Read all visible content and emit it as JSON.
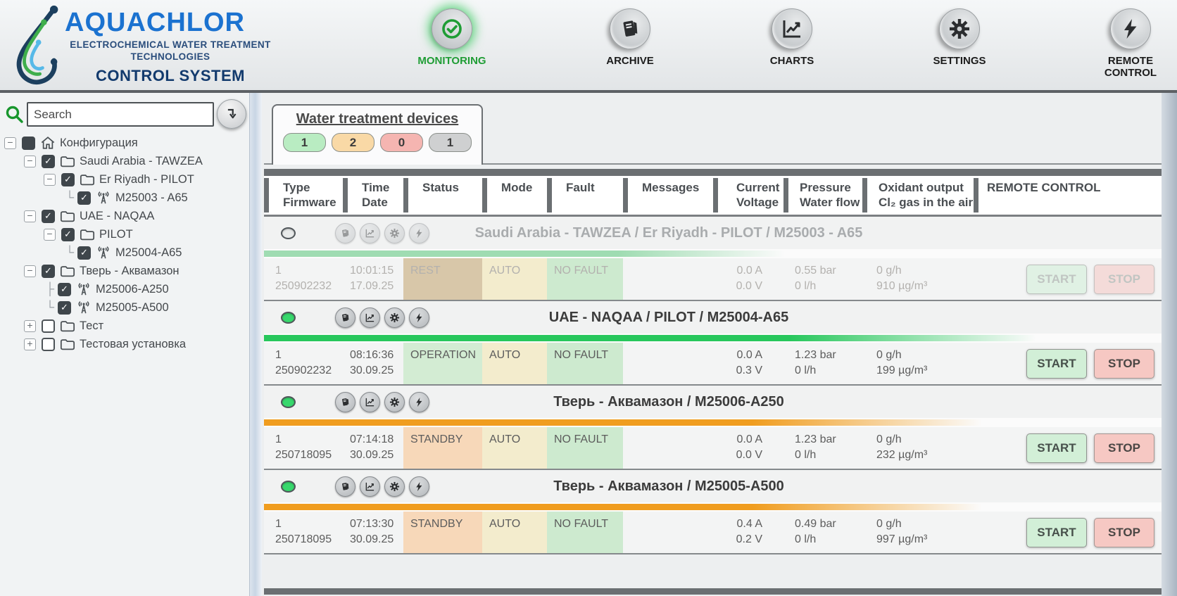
{
  "header": {
    "logo": {
      "title": "AQUACHLOR",
      "subtitle": "ELECTROCHEMICAL WATER TREATMENT TECHNOLOGIES",
      "tagline": "CONTROL SYSTEM"
    },
    "nav": [
      {
        "id": "monitoring",
        "label": "MONITORING",
        "icon": "check-circle",
        "active": true
      },
      {
        "id": "archive",
        "label": "ARCHIVE",
        "icon": "book",
        "active": false
      },
      {
        "id": "charts",
        "label": "CHARTS",
        "icon": "chart",
        "active": false
      },
      {
        "id": "settings",
        "label": "SETTINGS",
        "icon": "gear",
        "active": false
      },
      {
        "id": "remote",
        "label": "REMOTE CONTROL",
        "icon": "bolt",
        "active": false
      }
    ]
  },
  "sidebar": {
    "search_placeholder": "Search",
    "tree": [
      {
        "label": "Конфигурация",
        "level": 0,
        "expander": "minus",
        "checkbox": "filled",
        "icon": "home"
      },
      {
        "label": "Saudi Arabia - TAWZEA",
        "level": 1,
        "expander": "minus",
        "checkbox": "checked",
        "icon": "folder"
      },
      {
        "label": "Er Riyadh - PILOT",
        "level": 2,
        "expander": "minus",
        "checkbox": "checked",
        "icon": "folder"
      },
      {
        "label": "M25003 - A65",
        "level": 3,
        "connector": "└",
        "checkbox": "checked",
        "icon": "antenna"
      },
      {
        "label": "UAE - NAQAA",
        "level": 1,
        "expander": "minus",
        "checkbox": "checked",
        "icon": "folder"
      },
      {
        "label": "PILOT",
        "level": 2,
        "expander": "minus",
        "checkbox": "checked",
        "icon": "folder"
      },
      {
        "label": "M25004-A65",
        "level": 3,
        "connector": "└",
        "checkbox": "checked",
        "icon": "antenna"
      },
      {
        "label": "Тверь - Аквамазон",
        "level": 1,
        "expander": "minus",
        "checkbox": "checked",
        "icon": "folder"
      },
      {
        "label": "M25006-A250",
        "level": 2,
        "connector": "├",
        "checkbox": "checked",
        "icon": "antenna"
      },
      {
        "label": "M25005-A500",
        "level": 2,
        "connector": "└",
        "checkbox": "checked",
        "icon": "antenna"
      },
      {
        "label": "Тест",
        "level": 1,
        "expander": "plus",
        "checkbox": "empty",
        "icon": "folder"
      },
      {
        "label": "Тестовая установка",
        "level": 1,
        "expander": "plus",
        "checkbox": "empty",
        "icon": "folder"
      }
    ]
  },
  "main": {
    "tab": {
      "title": "Water treatment devices",
      "badges": [
        {
          "value": "1",
          "color": "badge_green"
        },
        {
          "value": "2",
          "color": "badge_orange"
        },
        {
          "value": "0",
          "color": "badge_red"
        },
        {
          "value": "1",
          "color": "badge_gray"
        }
      ]
    },
    "columns": [
      [
        "Type",
        "Firmware"
      ],
      [
        "Time",
        "Date"
      ],
      [
        "Status"
      ],
      [
        "Mode"
      ],
      [
        "Fault"
      ],
      [
        "Messages"
      ],
      [
        "Current",
        "Voltage"
      ],
      [
        "Pressure",
        "Water flow"
      ],
      [
        "Oxidant output",
        "Cl₂ gas in the air"
      ],
      [
        "REMOTE CONTROL"
      ]
    ],
    "buttons": {
      "start": "START",
      "stop": "STOP"
    },
    "devices": [
      {
        "name": "Saudi Arabia - TAWZEA / Er Riyadh - PILOT / M25003 - A65",
        "online": false,
        "type": "1",
        "firmware": "250902232",
        "time": "10:01:15",
        "date": "17.09.25",
        "status": "REST",
        "status_color": "status_rest",
        "mode": "AUTO",
        "mode_color": "mode_auto",
        "fault": "NO FAULT",
        "fault_color": "fault_ok",
        "messages": "",
        "current": "0.0 A",
        "voltage": "0.0 V",
        "pressure": "0.55 bar",
        "flow": "0 l/h",
        "oxidant": "0 g/h",
        "gas": "910 µg/m³",
        "bar_color": "bar_pale_green",
        "bar_width": "58%"
      },
      {
        "name": "UAE - NAQAA / PILOT / M25004-A65",
        "online": true,
        "type": "1",
        "firmware": "250902232",
        "time": "08:16:36",
        "date": "30.09.25",
        "status": "OPERATION",
        "status_color": "status_operation",
        "mode": "AUTO",
        "mode_color": "mode_auto",
        "fault": "NO FAULT",
        "fault_color": "fault_ok",
        "messages": "",
        "current": "0.0 A",
        "voltage": "0.3 V",
        "pressure": "1.23 bar",
        "flow": "0 l/h",
        "oxidant": "0 g/h",
        "gas": "199 µg/m³",
        "bar_color": "bar_green",
        "bar_width": "86%"
      },
      {
        "name": "Тверь - Аквамазон / M25006-A250",
        "online": true,
        "type": "1",
        "firmware": "250718095",
        "time": "07:14:18",
        "date": "30.09.25",
        "status": "STANDBY",
        "status_color": "status_standby",
        "mode": "AUTO",
        "mode_color": "mode_auto",
        "fault": "NO FAULT",
        "fault_color": "fault_ok",
        "messages": "",
        "current": "0.0 A",
        "voltage": "0.0 V",
        "pressure": "1.23 bar",
        "flow": "0 l/h",
        "oxidant": "0 g/h",
        "gas": "232 µg/m³",
        "bar_color": "bar_orange",
        "bar_width": "80%"
      },
      {
        "name": "Тверь - Аквамазон / M25005-A500",
        "online": true,
        "type": "1",
        "firmware": "250718095",
        "time": "07:13:30",
        "date": "30.09.25",
        "status": "STANDBY",
        "status_color": "status_standby",
        "mode": "AUTO",
        "mode_color": "mode_auto",
        "fault": "NO FAULT",
        "fault_color": "fault_ok",
        "messages": "",
        "current": "0.4 A",
        "voltage": "0.2 V",
        "pressure": "0.49 bar",
        "flow": "0 l/h",
        "oxidant": "0 g/h",
        "gas": "997 µg/m³",
        "bar_color": "bar_orange",
        "bar_width": "80%"
      }
    ]
  },
  "colors": {
    "accent_green": "#1f9d35",
    "badge_green": "#b9ecc2",
    "badge_orange": "#f9d9a6",
    "badge_red": "#f5b5b1",
    "badge_gray": "#cfd0d1",
    "status_rest": "#d8c7a9",
    "status_operation": "#d3ecd3",
    "status_standby": "#f7d8b9",
    "mode_auto": "#f3eccd",
    "fault_ok": "#cdeacf",
    "bar_pale_green": "#9fdcb2",
    "bar_green": "#27c75c",
    "bar_orange": "#f09d1f",
    "online_dot": "#38d86d"
  }
}
